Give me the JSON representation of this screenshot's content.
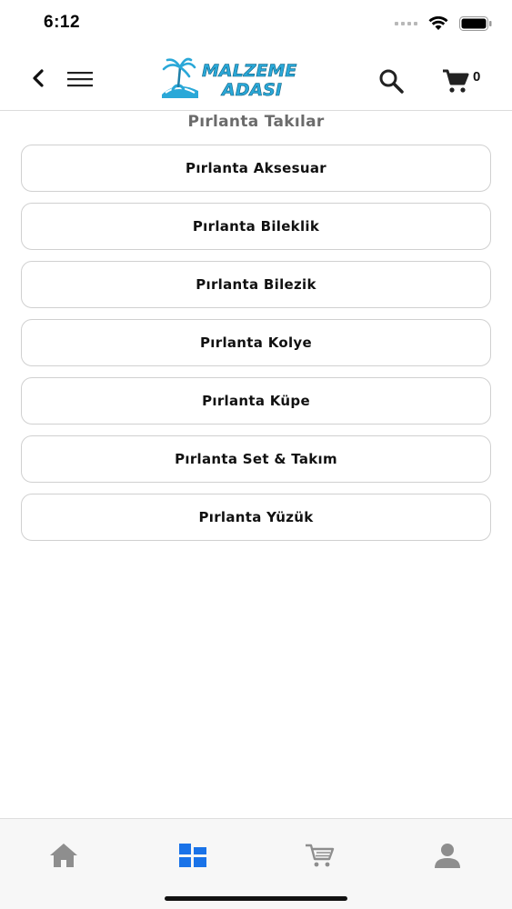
{
  "status_bar": {
    "time": "6:12"
  },
  "header": {
    "logo_line1": "MALZEME",
    "logo_line2": "ADASI",
    "cart_count": "0",
    "icons": [
      "back-chevron-icon",
      "hamburger-menu-icon",
      "search-icon",
      "cart-icon"
    ]
  },
  "page": {
    "title": "Pırlanta Takılar"
  },
  "categories": [
    {
      "label": "Pırlanta Aksesuar"
    },
    {
      "label": "Pırlanta Bileklik"
    },
    {
      "label": "Pırlanta Bilezik"
    },
    {
      "label": "Pırlanta Kolye"
    },
    {
      "label": "Pırlanta Küpe"
    },
    {
      "label": "Pırlanta Set & Takım"
    },
    {
      "label": "Pırlanta Yüzük"
    }
  ],
  "tab_bar": {
    "tabs": [
      {
        "icon": "home-icon",
        "active": false
      },
      {
        "icon": "categories-icon",
        "active": true
      },
      {
        "icon": "cart-icon",
        "active": false
      },
      {
        "icon": "profile-icon",
        "active": false
      }
    ],
    "active_color": "#1a73e8",
    "inactive_color": "#8e8e8e"
  },
  "colors": {
    "logo_blue": "#2aa8d8",
    "title_gray": "#6b6b6b",
    "border": "#d0d0d0"
  }
}
